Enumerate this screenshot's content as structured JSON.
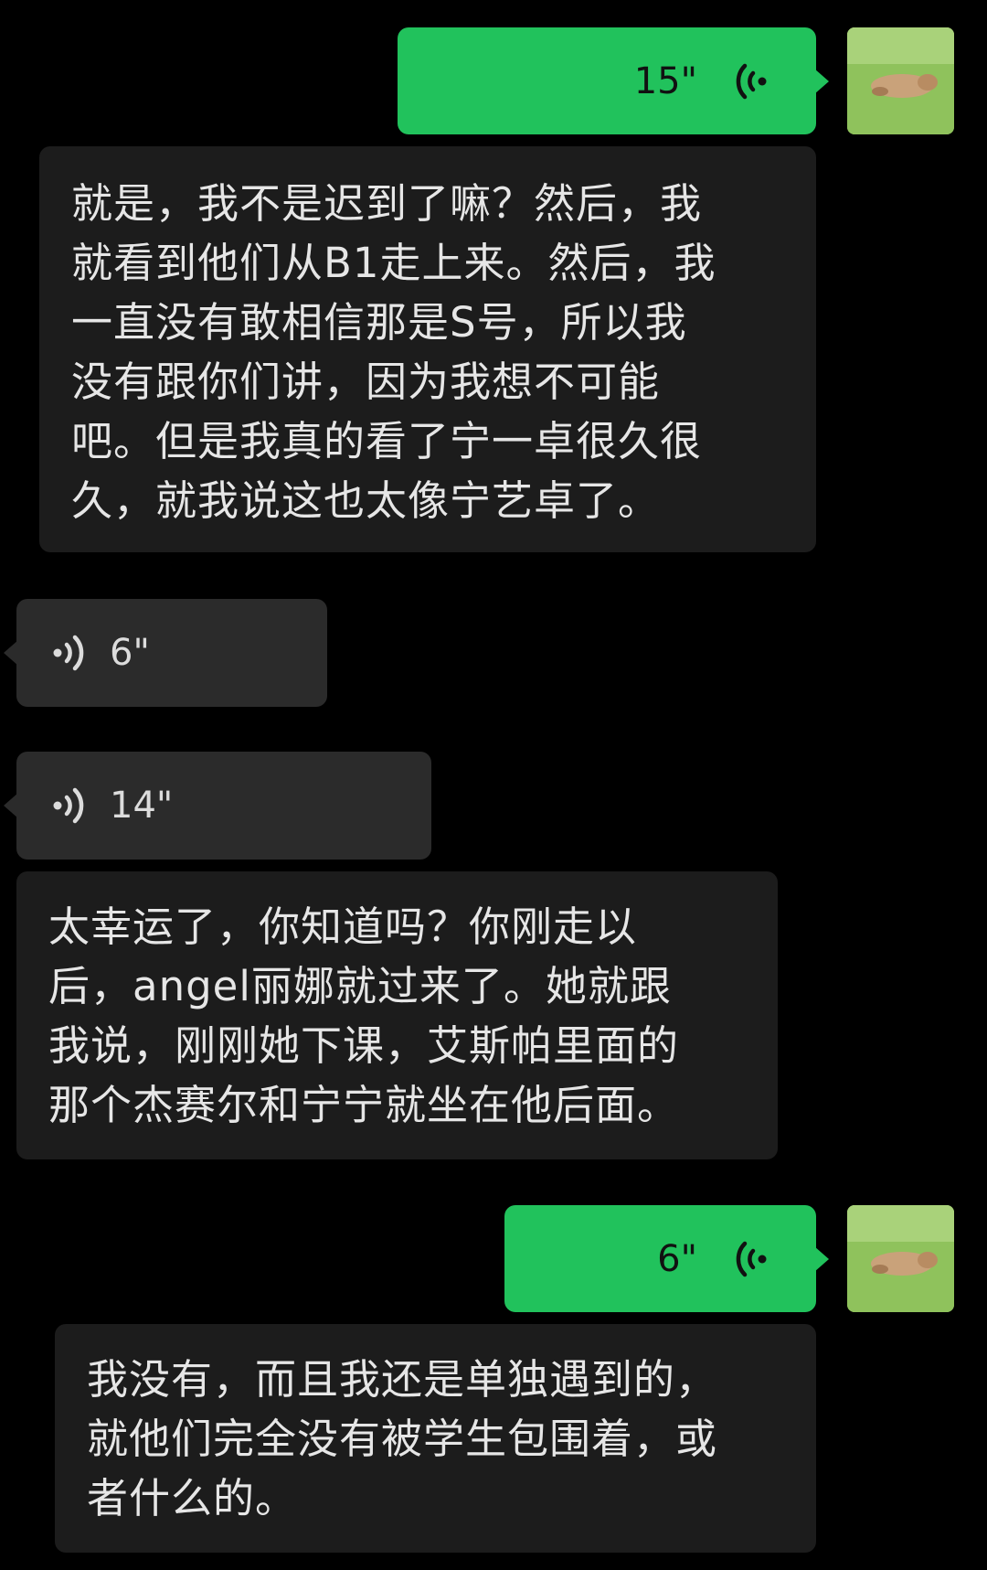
{
  "messages": [
    {
      "type": "voice",
      "side": "right",
      "duration": "15\""
    },
    {
      "type": "transcript",
      "text": "就是，我不是迟到了嘛？然后，我\n就看到他们从B1走上来。然后，我\n一直没有敢相信那是S号，所以我\n没有跟你们讲，因为我想不可能\n吧。但是我真的看了宁一卓很久很\n久，就我说这也太像宁艺卓了。"
    },
    {
      "type": "voice",
      "side": "left",
      "duration": "6\""
    },
    {
      "type": "voice",
      "side": "left",
      "duration": "14\""
    },
    {
      "type": "transcript",
      "text": "太幸运了，你知道吗？你刚走以\n后，angel丽娜就过来了。她就跟\n我说，刚刚她下课，艾斯帕里面的\n那个杰赛尔和宁宁就坐在他后面。"
    },
    {
      "type": "voice",
      "side": "right",
      "duration": "6\""
    },
    {
      "type": "transcript",
      "text": "我没有，而且我还是单独遇到的，\n就他们完全没有被学生包围着，或\n者什么的。"
    }
  ],
  "colors": {
    "background": "#000000",
    "outgoing_bubble": "#21c25c",
    "incoming_bubble": "#2b2b2b",
    "transcript_bubble": "#1c1c1c"
  },
  "icons": {
    "voice_out": "voice-wave-icon",
    "voice_in": "voice-wave-icon",
    "avatar": "cat-on-grass-avatar"
  }
}
